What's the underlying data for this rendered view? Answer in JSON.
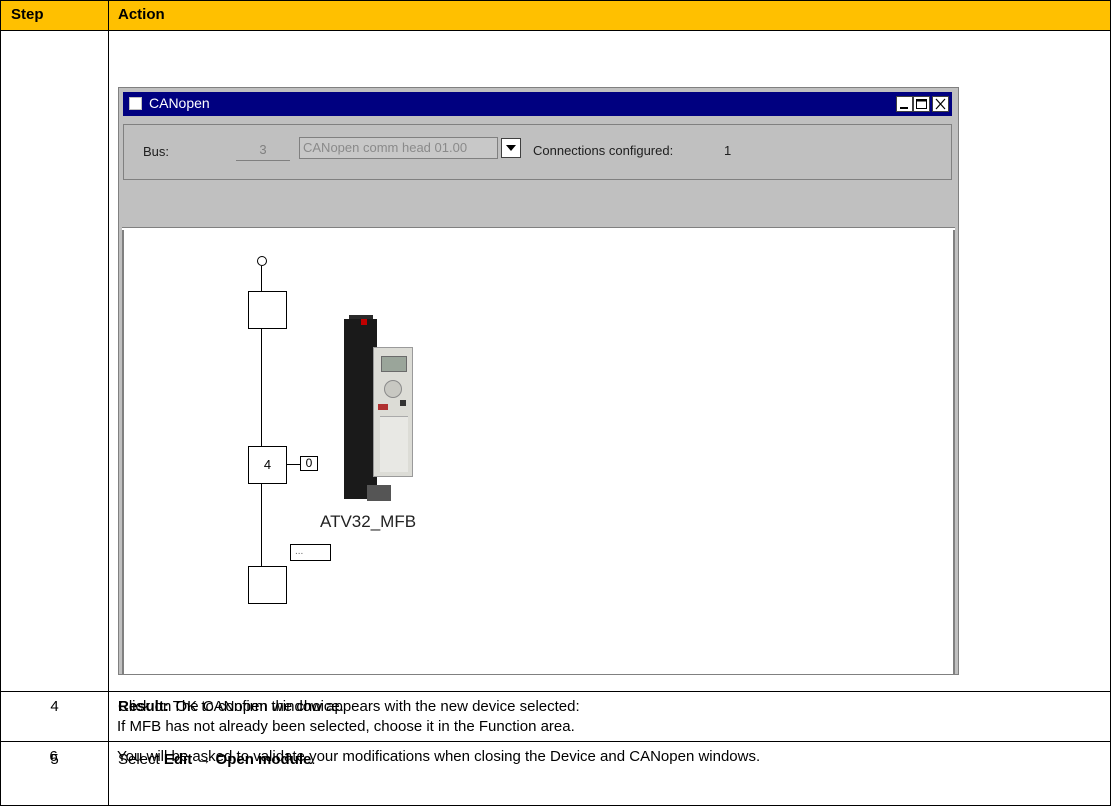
{
  "table": {
    "header": {
      "step": "Step",
      "action": "Action"
    },
    "rows": [
      {
        "step": "4",
        "line1": "Click on OK to confirm the choice.",
        "result_label": "Result:",
        "result_text": " The CANopen window appears with the new device selected:"
      },
      {
        "step": "5",
        "line1_prefix": "Select ",
        "line1_bold": "Edit → Open module",
        "line1_suffix": ".",
        "line2": "If MFB has not already been selected, choose it in the Function area."
      },
      {
        "step": "6",
        "line1": "You will be asked to validate your modifications when closing the Device and CANopen windows."
      }
    ]
  },
  "canopen_window": {
    "title": "CANopen",
    "bus_label": "Bus:",
    "bus_number": "3",
    "bus_module": "CANopen comm head 01.00",
    "connections_label": "Connections configured:",
    "connections_value": "1",
    "nodes": [
      {
        "label": ""
      },
      {
        "label": "4",
        "port": "0"
      },
      {
        "label": ""
      }
    ],
    "ellipsis_label": "...",
    "device_name": "ATV32_MFB"
  },
  "colors": {
    "header_bg": "#ffc000",
    "titlebar_bg": "#000080",
    "window_bg": "#c0c0c0"
  }
}
